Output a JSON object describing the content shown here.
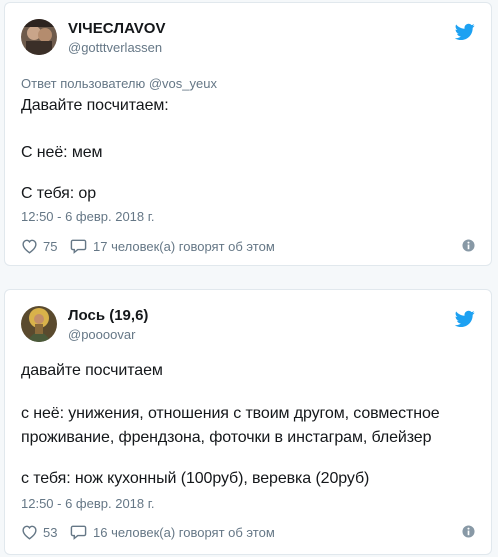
{
  "tweets": [
    {
      "author": {
        "name": "VIЧECЛAVOV",
        "handle": "@gotttverlassen"
      },
      "reply_to": {
        "prefix": "Ответ пользователю",
        "mention": "@vos_yeux"
      },
      "lines": [
        "Давайте посчитаем:",
        "С неё: мем",
        "С тебя: ор"
      ],
      "timestamp": "12:50 - 6 февр. 2018 г.",
      "likes": "75",
      "replies_text": "17 человек(а) говорят об этом"
    },
    {
      "author": {
        "name": "Лось (19,6)",
        "handle": "@poooovar"
      },
      "lines": [
        "давайте посчитаем",
        "с неё: унижения, отношения с твоим другом, совместное",
        "проживание, френдзона, фоточки в инстаграм, блейзер",
        "с тебя: нож кухонный (100руб), веревка (20руб)"
      ],
      "timestamp": "12:50 - 6 февр. 2018 г.",
      "likes": "53",
      "replies_text": "16 человек(а) говорят об этом"
    }
  ],
  "icons": {
    "brand": "twitter-bird-icon",
    "like": "heart-icon",
    "reply": "speech-bubble-icon",
    "info": "info-icon"
  },
  "colors": {
    "twitter_blue": "#1da1f2",
    "secondary_text": "#657786",
    "border": "#e1e8ed",
    "background": "#f5f8fa"
  }
}
